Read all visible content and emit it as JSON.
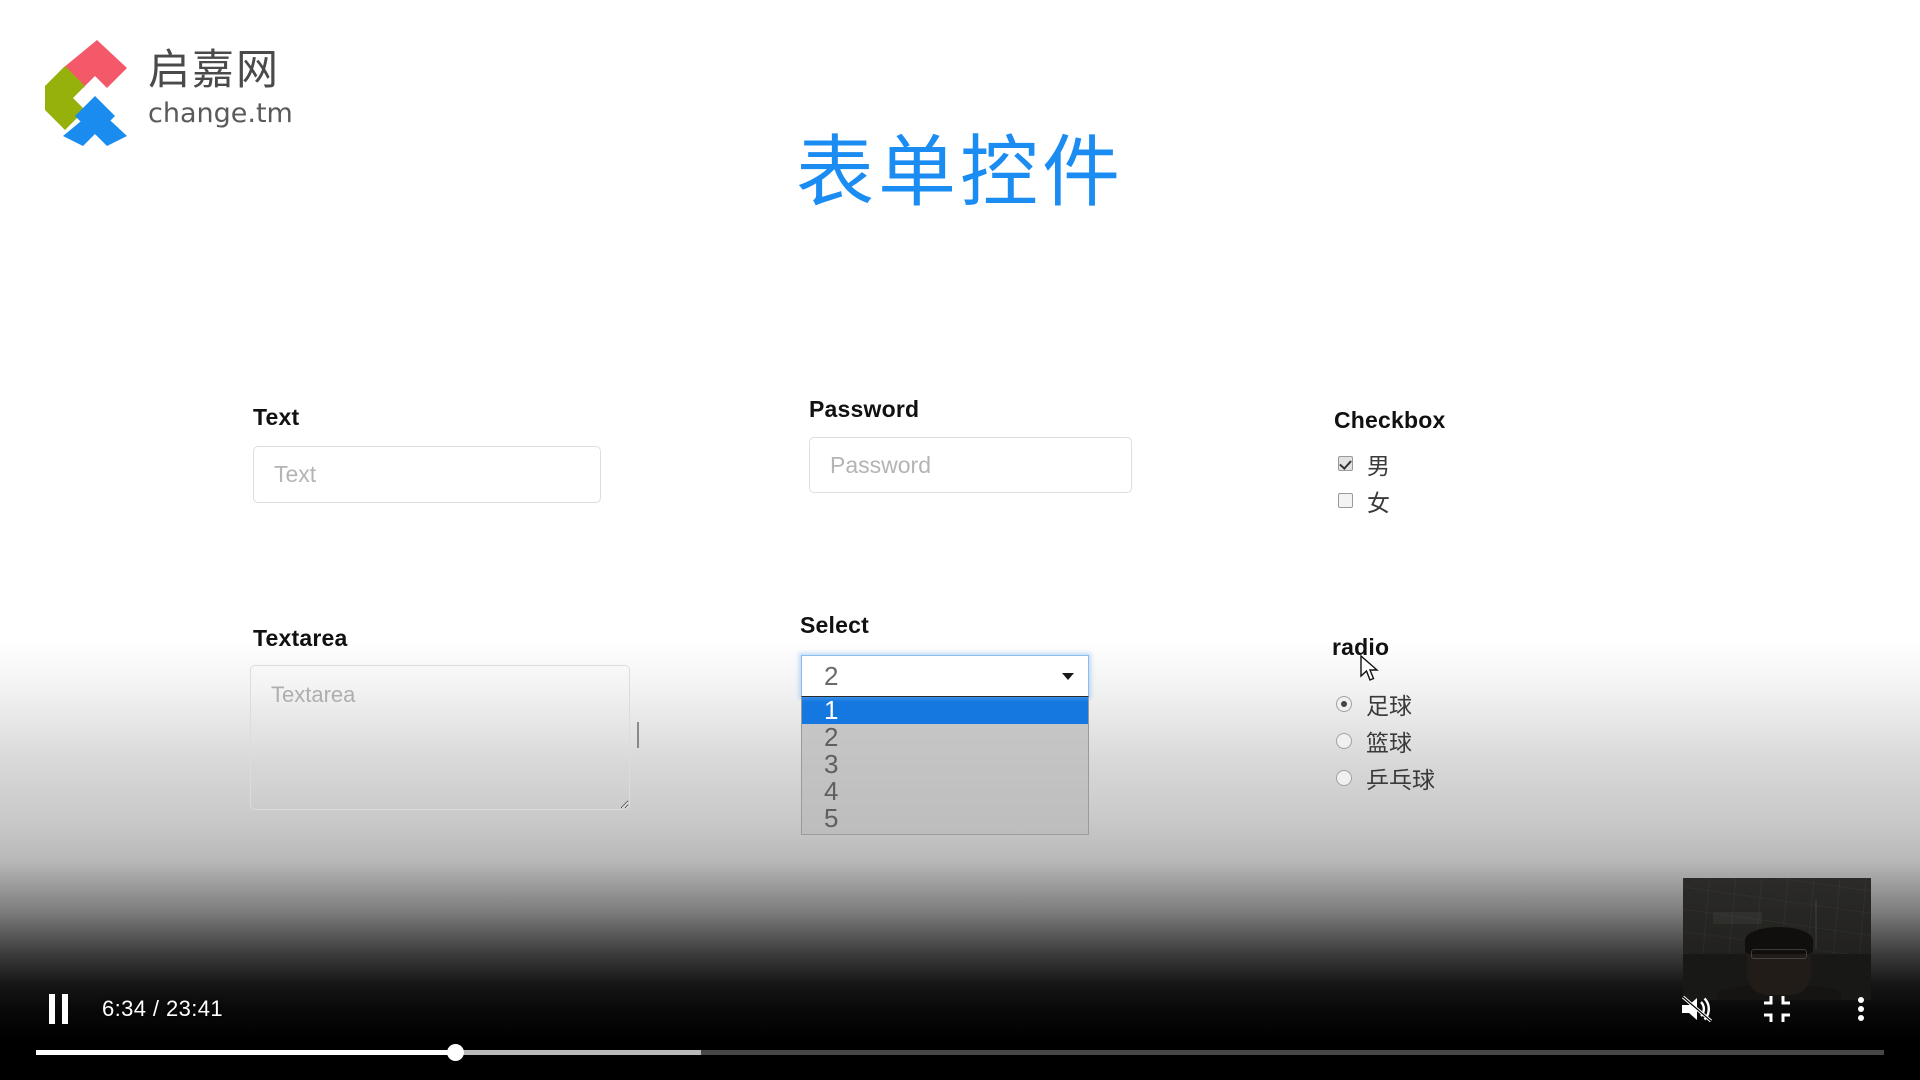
{
  "brand": {
    "logo_icon": "change-tm-logo-icon",
    "chinese_name": "启嘉网",
    "latin_name": "change.tm",
    "colors": {
      "red": "#f4596a",
      "olive": "#96b00c",
      "blue": "#1a8cf0"
    }
  },
  "page": {
    "title": "表单控件",
    "title_color": "#1b8cf2"
  },
  "form": {
    "text": {
      "label": "Text",
      "placeholder": "Text",
      "value": ""
    },
    "password": {
      "label": "Password",
      "placeholder": "Password",
      "value": ""
    },
    "checkbox": {
      "label": "Checkbox",
      "options": [
        {
          "label": "男",
          "checked": true
        },
        {
          "label": "女",
          "checked": false
        }
      ]
    },
    "textarea": {
      "label": "Textarea",
      "placeholder": "Textarea",
      "value": ""
    },
    "select": {
      "label": "Select",
      "value": "2",
      "expanded": true,
      "highlighted": "1",
      "caret_icon": "chevron-down-icon",
      "options": [
        "1",
        "2",
        "3",
        "4",
        "5"
      ]
    },
    "radio": {
      "label": "radio",
      "options": [
        {
          "label": "足球",
          "checked": true
        },
        {
          "label": "篮球",
          "checked": false
        },
        {
          "label": "乒乓球",
          "checked": false
        }
      ]
    }
  },
  "player": {
    "pause_icon": "pause-icon",
    "pause_label": "Pause",
    "time_display": "6:34 / 23:41",
    "current_time": "6:34",
    "duration": "23:41",
    "progress_percent": 22.7,
    "buffered_percent": 36,
    "mute_icon": "volume-muted-icon",
    "mute_label": "Unmute",
    "fullscreen_icon": "exit-fullscreen-icon",
    "fullscreen_label": "Exit full screen",
    "more_icon": "more-vertical-icon",
    "more_label": "More options"
  },
  "webcam": {
    "label": "presenter-webcam"
  },
  "cursors": {
    "pointer_icon": "mouse-pointer-icon",
    "text_caret_icon": "text-caret-icon"
  }
}
